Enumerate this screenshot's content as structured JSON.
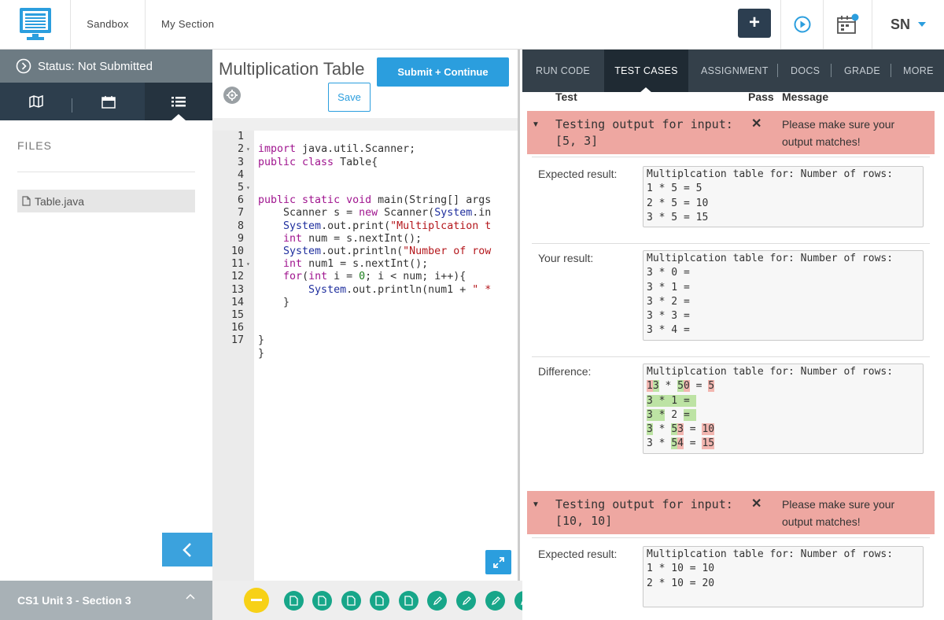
{
  "topbar": {
    "logo_icon": "computer-monitor-icon",
    "nav": {
      "sandbox": "Sandbox",
      "my_section": "My Section"
    },
    "plus_label": "+",
    "user_initials": "SN"
  },
  "sidebar": {
    "status": "Status: Not Submitted",
    "files_heading": "FILES",
    "file_name": "Table.java",
    "section_label": "CS1 Unit 3 - Section 3"
  },
  "editor": {
    "title": "Multiplication Table",
    "submit_label": "Submit + Continue",
    "save_label": "Save",
    "lines": [
      {
        "n": "1",
        "text": "import java.util.Scanner;"
      },
      {
        "n": "2",
        "text": "public class Table{"
      },
      {
        "n": "3",
        "text": ""
      },
      {
        "n": "4",
        "text": ""
      },
      {
        "n": "5",
        "text": "public static void main(String[] args"
      },
      {
        "n": "6",
        "text": "    Scanner s = new Scanner(System.in"
      },
      {
        "n": "7",
        "text": "    System.out.print(\"Multiplcation t"
      },
      {
        "n": "8",
        "text": "    int num = s.nextInt();"
      },
      {
        "n": "9",
        "text": "    System.out.println(\"Number of row"
      },
      {
        "n": "10",
        "text": "    int num1 = s.nextInt();"
      },
      {
        "n": "11",
        "text": "    for(int i = 0; i < num; i++){"
      },
      {
        "n": "12",
        "text": "        System.out.println(num1 + \" *"
      },
      {
        "n": "13",
        "text": "    }"
      },
      {
        "n": "14",
        "text": ""
      },
      {
        "n": "15",
        "text": ""
      },
      {
        "n": "16",
        "text": "}"
      },
      {
        "n": "17",
        "text": "}"
      }
    ]
  },
  "right": {
    "tabs": [
      "RUN CODE",
      "TEST CASES",
      "ASSIGNMENT",
      "DOCS",
      "GRADE",
      "MORE"
    ],
    "headers": {
      "test": "Test",
      "pass": "Pass",
      "message": "Message"
    },
    "tests": [
      {
        "name": "Testing output for input:\n[5, 3]",
        "pass_mark": "✕",
        "message": "Please make sure your output matches!",
        "expected_label": "Expected result:",
        "expected": "Multiplcation table for: Number of rows:\n1 * 5 = 5\n2 * 5 = 10\n3 * 5 = 15",
        "yours_label": "Your result:",
        "yours": "Multiplcation table for: Number of rows:\n3 * 0 =\n3 * 1 =\n3 * 2 =\n3 * 3 =\n3 * 4 =",
        "diff_label": "Difference:"
      },
      {
        "name": "Testing output for input:\n[10, 10]",
        "pass_mark": "✕",
        "message": "Please make sure your output matches!",
        "expected_label": "Expected result:",
        "expected": "Multiplcation table for: Number of rows:\n1 * 10 = 10\n2 * 10 = 20"
      }
    ]
  },
  "colors": {
    "accent": "#2b9ede",
    "dark_nav": "#2d3e4d",
    "fail": "#eea7a1",
    "done_step": "#17a689",
    "current_step": "#f7d117"
  }
}
